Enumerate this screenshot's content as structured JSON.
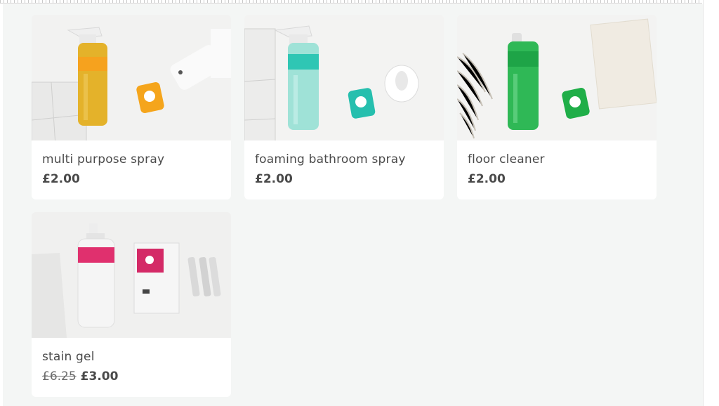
{
  "products": [
    {
      "name": "multi purpose spray",
      "price": "£2.00",
      "accent": "#f4a11f",
      "liquid": "#e3b62a",
      "icon": "spray-bottle-icon"
    },
    {
      "name": "foaming bathroom spray",
      "price": "£2.00",
      "accent": "#2fc4b2",
      "liquid": "#8fded2",
      "icon": "spray-bottle-icon"
    },
    {
      "name": "floor cleaner",
      "price": "£2.00",
      "accent": "#1faf4a",
      "liquid": "#36c060",
      "icon": "bottle-icon"
    },
    {
      "name": "stain gel",
      "old_price": "£6.25",
      "price": "£3.00",
      "accent": "#e0306e",
      "liquid": "#f2f2f2",
      "icon": "pump-bottle-icon"
    }
  ]
}
